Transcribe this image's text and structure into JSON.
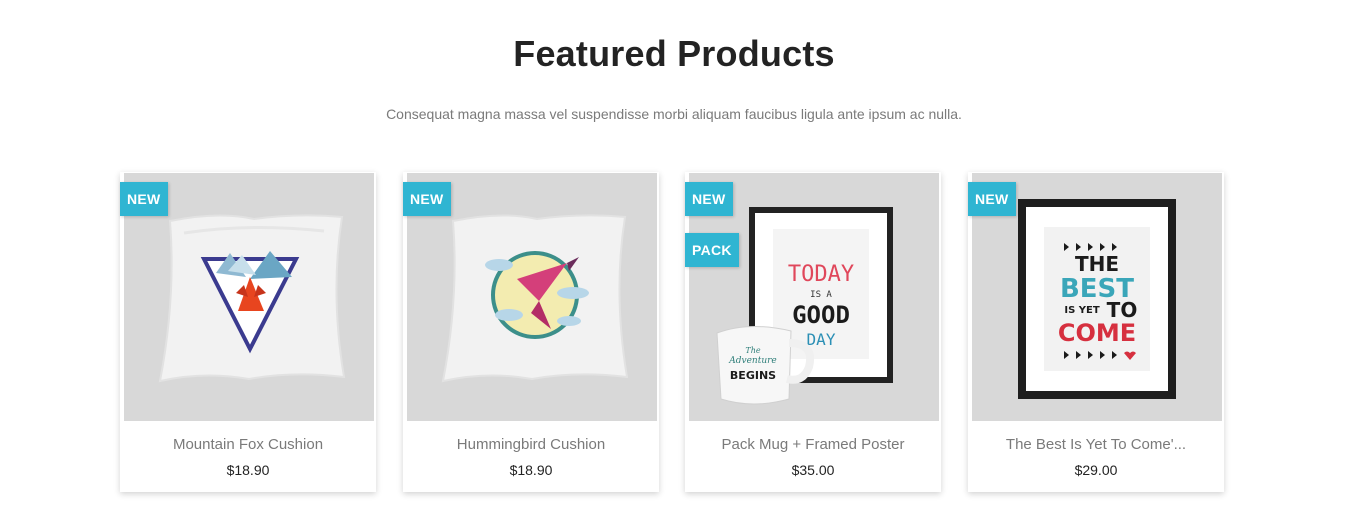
{
  "section": {
    "title": "Featured Products",
    "subtitle": "Consequat magna massa vel suspendisse morbi aliquam faucibus ligula ante ipsum ac nulla."
  },
  "colors": {
    "accent": "#2fb5d2",
    "text_dark": "#232323",
    "text_muted": "#7a7a7a",
    "image_bg": "#d8d8d8"
  },
  "products": [
    {
      "name": "Mountain Fox Cushion",
      "price": "$18.90",
      "flags": [
        "NEW"
      ],
      "image": "fox-cushion-image"
    },
    {
      "name": "Hummingbird Cushion",
      "price": "$18.90",
      "flags": [
        "NEW"
      ],
      "image": "hummingbird-cushion-image"
    },
    {
      "name": "Pack Mug + Framed Poster",
      "price": "$35.00",
      "flags": [
        "NEW",
        "PACK"
      ],
      "image": "mug-poster-pack-image",
      "poster_text": [
        "TODAY",
        "IS A",
        "GOOD",
        "DAY"
      ],
      "mug_text": [
        "The",
        "Adventure",
        "BEGINS"
      ]
    },
    {
      "name": "The Best Is Yet To Come'...",
      "price": "$29.00",
      "flags": [
        "NEW"
      ],
      "image": "framed-poster-image",
      "poster_text": [
        "THE",
        "BEST",
        "IS YET",
        "TO",
        "COME"
      ]
    }
  ]
}
